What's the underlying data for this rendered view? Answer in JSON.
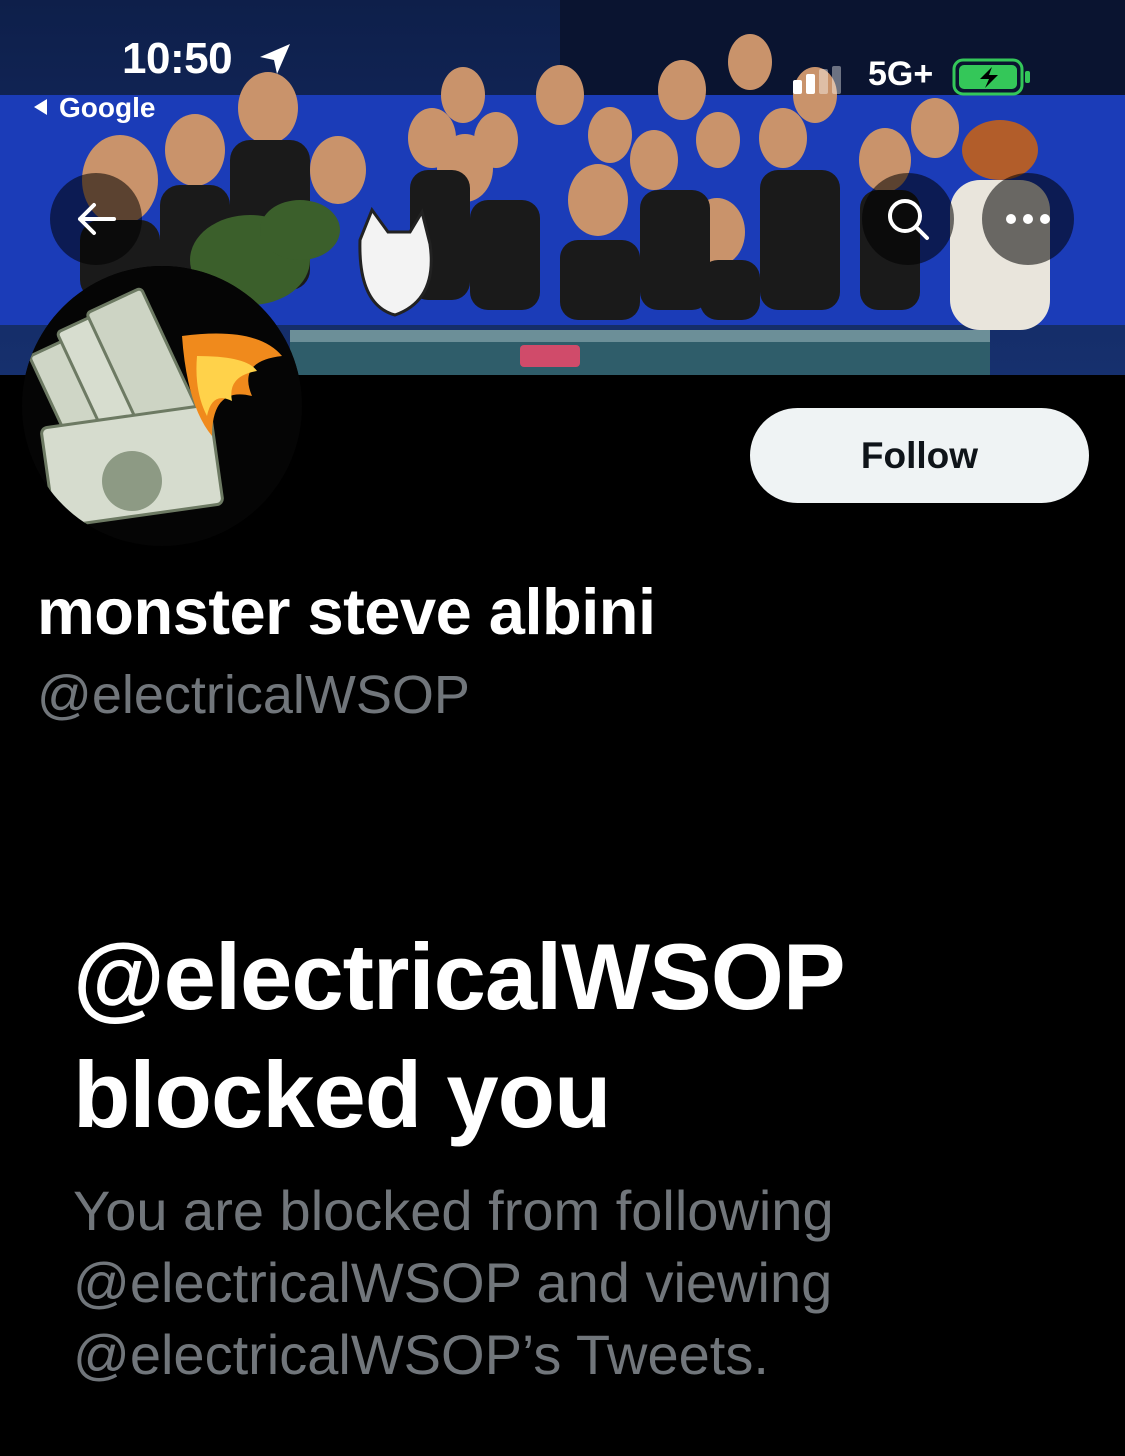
{
  "status_bar": {
    "time": "10:50",
    "back_app": "Google",
    "network": "5G+"
  },
  "icons": {
    "back": "arrow-left-icon",
    "search": "search-icon",
    "more": "more-horizontal-icon",
    "location": "location-arrow-icon",
    "signal": "cellular-signal-icon",
    "battery": "battery-charging-icon"
  },
  "profile": {
    "display_name": "monster steve albini",
    "handle": "@electricalWSOP",
    "follow_label": "Follow"
  },
  "blocked": {
    "title": "@electricalWSOP blocked you",
    "description": "You are blocked from following @electricalWSOP and viewing @electricalWSOP’s Tweets."
  },
  "colors": {
    "background": "#000000",
    "secondary_text": "#71767b",
    "follow_bg": "#eff3f4",
    "follow_text": "#0f1419",
    "battery": "#34c759"
  }
}
